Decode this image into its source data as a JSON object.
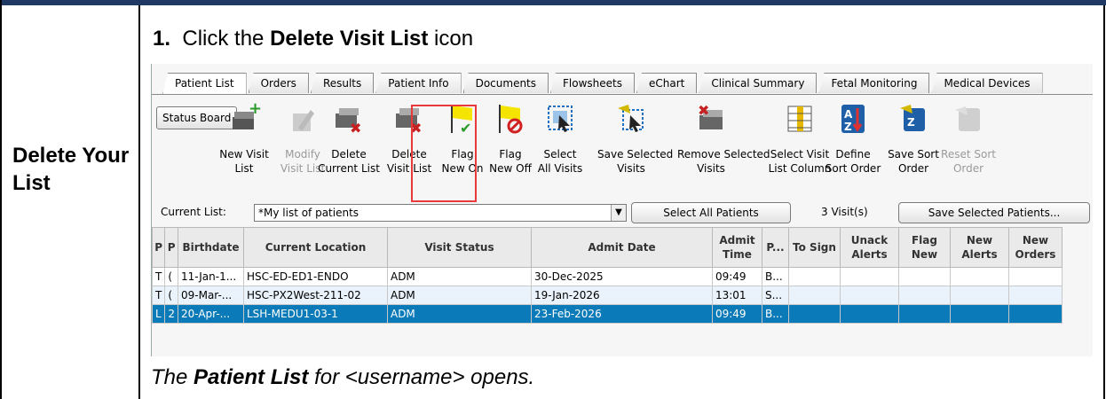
{
  "doc": {
    "step_label": "Delete Your List",
    "step_number": "1.",
    "step_text_pre": "Click the",
    "step_text_bold": "Delete Visit List",
    "step_text_post": "icon",
    "result_pre": "The",
    "result_bold": "Patient List",
    "result_post": "for <username> opens."
  },
  "app": {
    "tabs": [
      "Patient List",
      "Orders",
      "Results",
      "Patient Info",
      "Documents",
      "Flowsheets",
      "eChart",
      "Clinical Summary",
      "Fetal Monitoring",
      "Medical Devices"
    ],
    "status_board": "Status Board",
    "toolbar": [
      {
        "label1": "New Visit",
        "label2": "List",
        "icon": "new-visit-list-icon",
        "disabled": false
      },
      {
        "label1": "Modify",
        "label2": "Visit List",
        "icon": "modify-visit-list-icon",
        "disabled": true
      },
      {
        "label1": "Delete",
        "label2": "Current List",
        "icon": "delete-current-list-icon",
        "disabled": false
      },
      {
        "label1": "Delete",
        "label2": "Visit List",
        "icon": "delete-visit-list-icon",
        "disabled": false
      },
      {
        "label1": "Flag",
        "label2": "New On",
        "icon": "flag-new-on-icon",
        "disabled": false
      },
      {
        "label1": "Flag",
        "label2": "New Off",
        "icon": "flag-new-off-icon",
        "disabled": false
      },
      {
        "label1": "Select",
        "label2": "All Visits",
        "icon": "select-all-visits-icon",
        "disabled": false
      },
      {
        "label1": "Save Selected",
        "label2": "Visits",
        "icon": "save-selected-visits-icon",
        "disabled": false
      },
      {
        "label1": "Remove Selected",
        "label2": "Visits",
        "icon": "remove-selected-visits-icon",
        "disabled": false
      },
      {
        "label1": "Select Visit",
        "label2": "List Column",
        "icon": "select-visit-list-column-icon",
        "disabled": false
      },
      {
        "label1": "Define",
        "label2": "Sort Order",
        "icon": "define-sort-order-icon",
        "disabled": false
      },
      {
        "label1": "Save Sort",
        "label2": "Order",
        "icon": "save-sort-order-icon",
        "disabled": false
      },
      {
        "label1": "Reset Sort",
        "label2": "Order",
        "icon": "reset-sort-order-icon",
        "disabled": true
      }
    ],
    "current_list_label": "Current List:",
    "current_list_value": "*My list of patients",
    "select_all_patients": "Select All Patients",
    "visit_count": "3 Visit(s)",
    "save_selected_patients": "Save Selected Patients...",
    "columns": [
      "P",
      "P",
      "Birthdate",
      "Current Location",
      "Visit Status",
      "Admit Date",
      "Admit Time",
      "P...",
      "To Sign",
      "Unack Alerts",
      "Flag New",
      "New Alerts",
      "New Orders"
    ],
    "rows": [
      [
        "T",
        "(",
        "11-Jan-1...",
        "HSC-ED-ED1-ENDO",
        "ADM",
        "30-Dec-2025",
        "09:49",
        "B...",
        "",
        "",
        "",
        "",
        ""
      ],
      [
        "T",
        "(",
        "09-Mar-...",
        "HSC-PX2West-211-02",
        "ADM",
        "19-Jan-2026",
        "13:01",
        "S...",
        "",
        "",
        "",
        "",
        ""
      ],
      [
        "L",
        "2",
        "20-Apr-...",
        "LSH-MEDU1-03-1",
        "ADM",
        "23-Feb-2026",
        "09:49",
        "B...",
        "",
        "",
        "",
        "",
        ""
      ]
    ],
    "colors": {
      "selected_row": "#0a7bb8",
      "highlight_box": "#e8393c",
      "top_bar": "#1f3864"
    }
  }
}
